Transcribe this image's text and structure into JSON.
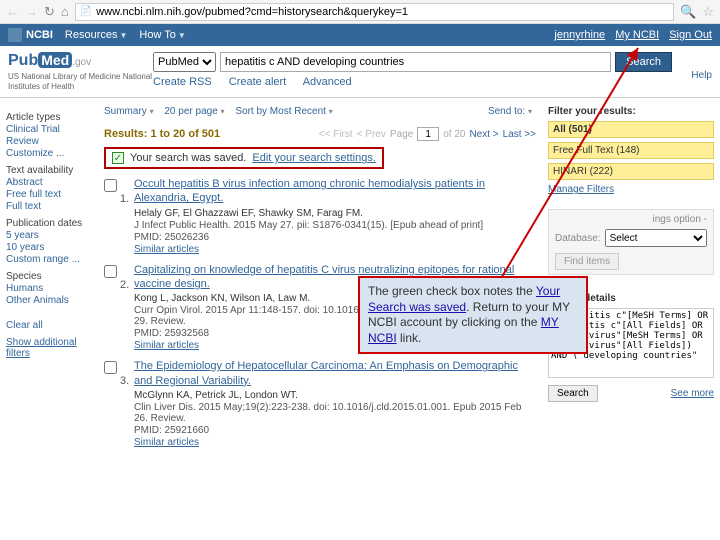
{
  "browser": {
    "url": "www.ncbi.nlm.nih.gov/pubmed?cmd=historysearch&querykey=1"
  },
  "ncbi_bar": {
    "brand": "NCBI",
    "menu": [
      "Resources",
      "How To"
    ],
    "user_links": {
      "user": "jennyrhine",
      "my_ncbi": "My NCBI",
      "signout": "Sign Out"
    }
  },
  "header": {
    "logo_pub": "Pub",
    "logo_med": "Med",
    "logo_gov": ".gov",
    "subtitle": "US National Library of Medicine\nNational Institutes of Health",
    "db_select": "PubMed",
    "query": "hepatitis c AND developing countries",
    "search_btn": "Search",
    "sublinks": {
      "rss": "Create RSS",
      "alert": "Create alert",
      "adv": "Advanced"
    },
    "help": "Help"
  },
  "filters_left": {
    "groups": [
      {
        "title": "Article types",
        "opts": [
          "Clinical Trial",
          "Review",
          "Customize ..."
        ]
      },
      {
        "title": "Text availability",
        "opts": [
          "Abstract",
          "Free full text",
          "Full text"
        ]
      },
      {
        "title": "Publication dates",
        "opts": [
          "5 years",
          "10 years",
          "Custom range ..."
        ]
      },
      {
        "title": "Species",
        "opts": [
          "Humans",
          "Other Animals"
        ]
      }
    ],
    "clear_all": "Clear all",
    "show_additional": "Show additional filters"
  },
  "toolbar": {
    "summary": "Summary",
    "perpage": "20 per page",
    "sort": "Sort by Most Recent",
    "sendto": "Send to:"
  },
  "results_header": {
    "label": "Results: 1 to 20 of 501",
    "pager": {
      "first": "<< First",
      "prev": "< Prev",
      "page_label": "Page",
      "page": "1",
      "of": "of 20",
      "next": "Next >",
      "last": "Last >>"
    }
  },
  "saved_notice": {
    "msg": "Your search was saved.",
    "edit": "Edit your search settings."
  },
  "results": [
    {
      "num": "1.",
      "title": "Occult hepatitis B virus infection among chronic hemodialysis patients in Alexandria, Egypt.",
      "authors": "Helaly GF, El Ghazzawi EF, Shawky SM, Farag FM.",
      "cite": "J Infect Public Health. 2015 May 27. pii: S1876-0341(15). [Epub ahead of print]",
      "pmid": "PMID: 25026236",
      "similar": "Similar articles"
    },
    {
      "num": "2.",
      "title": "Capitalizing on knowledge of hepatitis C virus neutralizing epitopes for rational vaccine design.",
      "authors": "Kong L, Jackson KN, Wilson IA, Law M.",
      "cite": "Curr Opin Virol. 2015 Apr 11:148-157. doi: 10.1016/j.coviro.2015.04.001. Epub 2015 Apr 29. Review.",
      "pmid": "PMID: 25932568",
      "similar": "Similar articles"
    },
    {
      "num": "3.",
      "title": "The Epidemiology of Hepatocellular Carcinoma: An Emphasis on Demographic and Regional Variability.",
      "authors": "McGlynn KA, Petrick JL, London WT.",
      "cite": "Clin Liver Dis. 2015 May;19(2):223-238. doi: 10.1016/j.cld.2015.01.001. Epub 2015 Feb 26. Review.",
      "pmid": "PMID: 25921660",
      "similar": "Similar articles"
    }
  ],
  "right": {
    "filter_head": "Filter your results:",
    "filters": [
      {
        "label": "All (501)",
        "sel": true
      },
      {
        "label": "Free Full Text (148)",
        "sel": false
      },
      {
        "label": "HINARI (222)",
        "sel": false
      }
    ],
    "manage": "Manage Filters",
    "ngs_hint": "ings option -",
    "db_label": "Database:",
    "db_value": "Select",
    "find": "Find items",
    "sd_head": "Search details",
    "sd_text": "(\"hepatitis c\"[MeSH Terms] OR \"hepatitis c\"[All Fields] OR \"hepacivirus\"[MeSH Terms] OR \"hepacivirus\"[All Fields]) AND (\"developing countries\"",
    "sd_search": "Search",
    "seemore": "See more"
  },
  "callout": {
    "t1": "The green check box notes the ",
    "t2": "Your Search was saved",
    "t3": ". Return to your MY NCBI account by clicking on the ",
    "t4": "MY NCBI",
    "t5": " link."
  }
}
